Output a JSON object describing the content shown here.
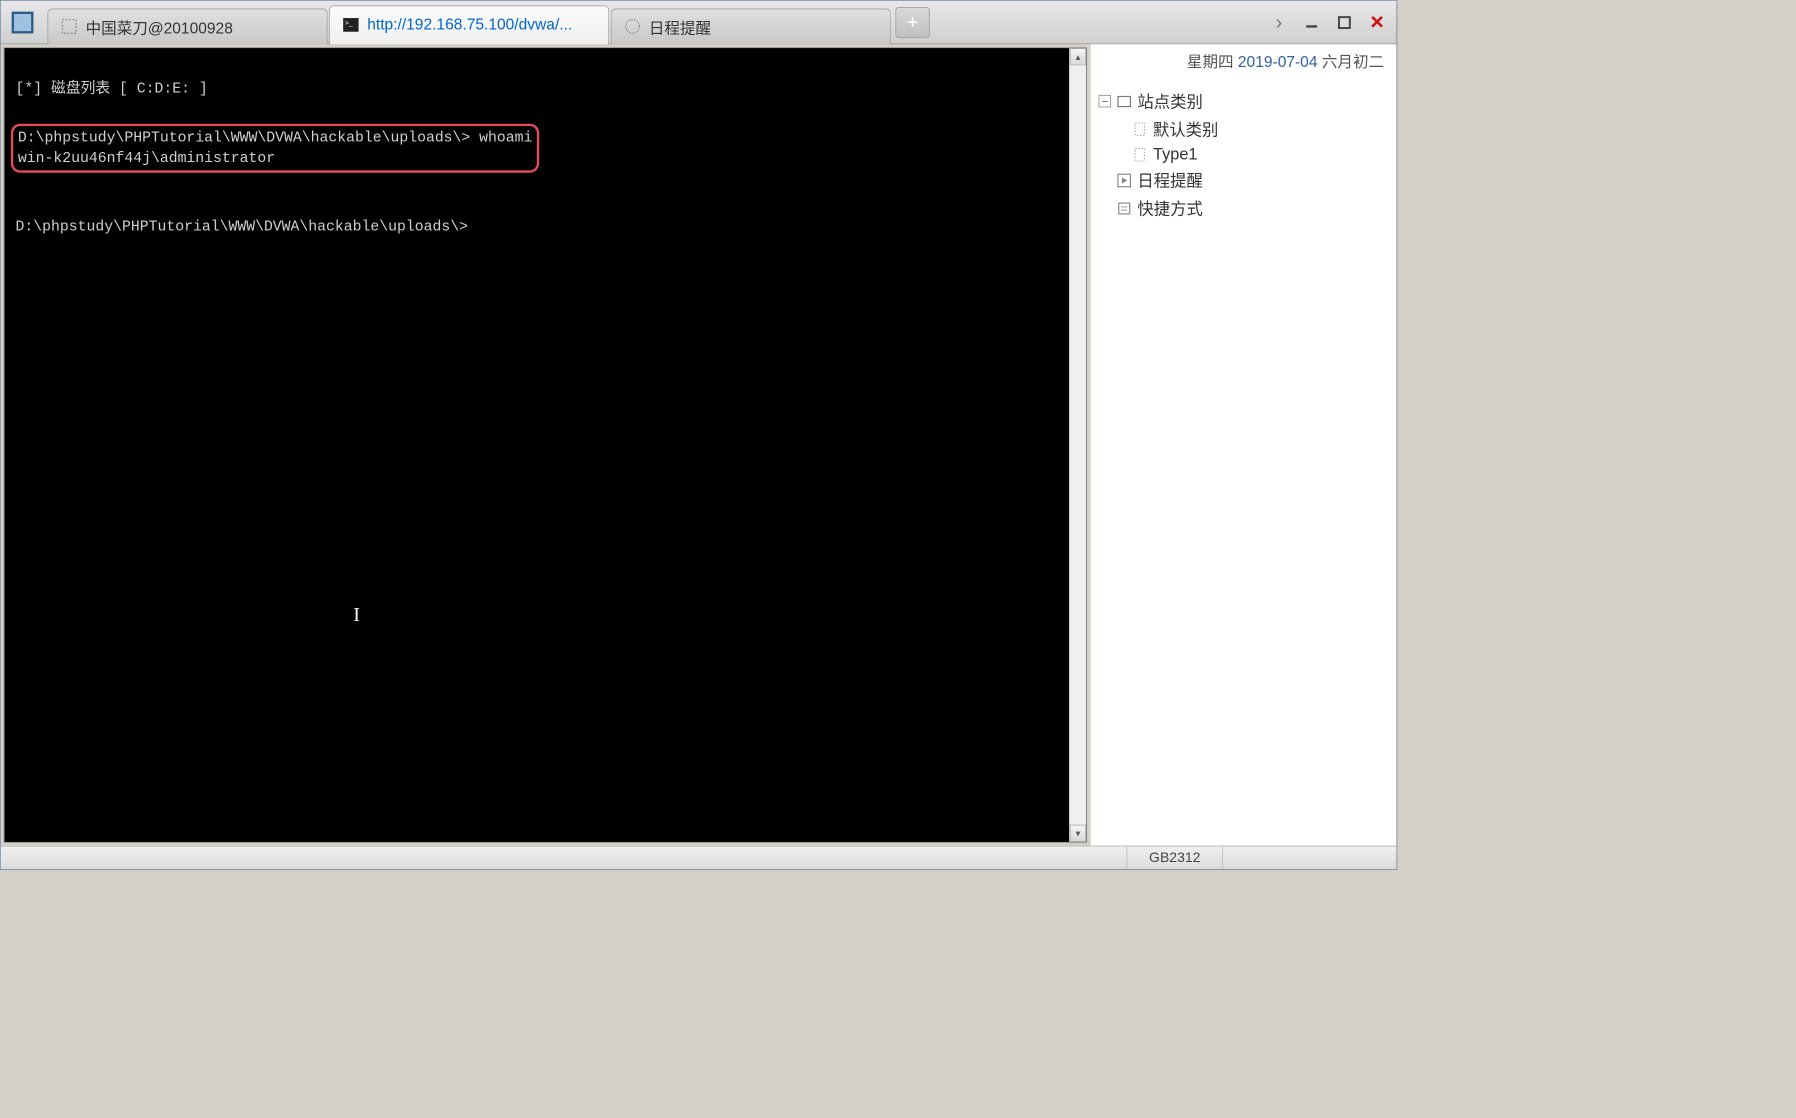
{
  "tabs": [
    {
      "label": "中国菜刀@20100928",
      "link": false
    },
    {
      "label": "http://192.168.75.100/dvwa/...",
      "link": true
    },
    {
      "label": "日程提醒",
      "link": false
    }
  ],
  "new_tab_label": "+",
  "window_controls": {
    "arrow": "›",
    "close": "×"
  },
  "date_bar": {
    "weekday": "星期四",
    "date": "2019-07-04",
    "lunar": "六月初二"
  },
  "terminal": {
    "line1": "[*] 磁盘列表 [ C:D:E: ]",
    "prompt1": "D:\\phpstudy\\PHPTutorial\\WWW\\DVWA\\hackable\\uploads\\> whoami",
    "output1": "win-k2uu46nf44j\\administrator",
    "prompt2": "D:\\phpstudy\\PHPTutorial\\WWW\\DVWA\\hackable\\uploads\\>"
  },
  "sidebar": {
    "tree": [
      {
        "label": "站点类别",
        "level": 0,
        "expandable": true,
        "icon": "folder"
      },
      {
        "label": "默认类别",
        "level": 1,
        "expandable": false,
        "icon": "doc"
      },
      {
        "label": "Type1",
        "level": 1,
        "expandable": false,
        "icon": "doc"
      },
      {
        "label": "日程提醒",
        "level": 0,
        "expandable": false,
        "icon": "play"
      },
      {
        "label": "快捷方式",
        "level": 0,
        "expandable": false,
        "icon": "note"
      }
    ]
  },
  "statusbar": {
    "encoding": "GB2312"
  }
}
